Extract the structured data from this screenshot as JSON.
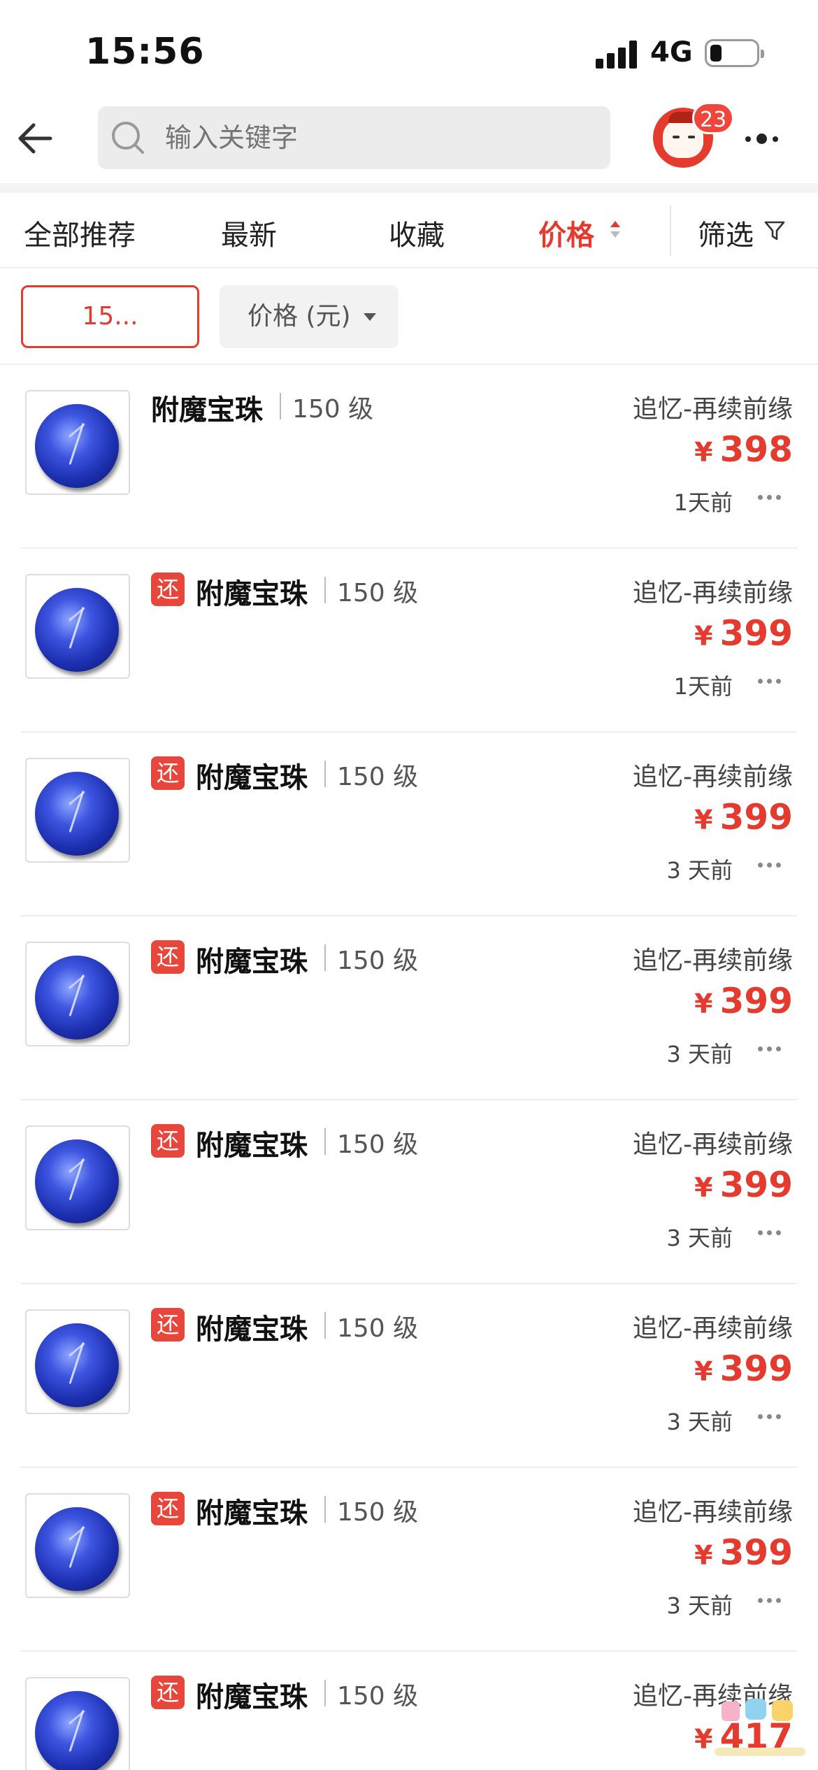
{
  "status_bar": {
    "time": "15:56",
    "network": "4G"
  },
  "header": {
    "search_placeholder": "输入关键字",
    "notification_count": "23"
  },
  "sort_tabs": [
    {
      "label": "全部推荐",
      "active": false
    },
    {
      "label": "最新",
      "active": false
    },
    {
      "label": "收藏",
      "active": false
    },
    {
      "label": "价格",
      "active": true
    },
    {
      "label": "筛选",
      "active": false
    }
  ],
  "filters": {
    "price_value": "15...",
    "price_unit": "价格 (元)"
  },
  "items": [
    {
      "tag": "",
      "name": "附魔宝珠",
      "level": "150 级",
      "server": "追忆-再续前缘",
      "currency": "¥",
      "price": "398",
      "time": "1天前"
    },
    {
      "tag": "还",
      "name": "附魔宝珠",
      "level": "150 级",
      "server": "追忆-再续前缘",
      "currency": "¥",
      "price": "399",
      "time": "1天前"
    },
    {
      "tag": "还",
      "name": "附魔宝珠",
      "level": "150 级",
      "server": "追忆-再续前缘",
      "currency": "¥",
      "price": "399",
      "time": "3 天前"
    },
    {
      "tag": "还",
      "name": "附魔宝珠",
      "level": "150 级",
      "server": "追忆-再续前缘",
      "currency": "¥",
      "price": "399",
      "time": "3 天前"
    },
    {
      "tag": "还",
      "name": "附魔宝珠",
      "level": "150 级",
      "server": "追忆-再续前缘",
      "currency": "¥",
      "price": "399",
      "time": "3 天前"
    },
    {
      "tag": "还",
      "name": "附魔宝珠",
      "level": "150 级",
      "server": "追忆-再续前缘",
      "currency": "¥",
      "price": "399",
      "time": "3 天前"
    },
    {
      "tag": "还",
      "name": "附魔宝珠",
      "level": "150 级",
      "server": "追忆-再续前缘",
      "currency": "¥",
      "price": "399",
      "time": "3 天前"
    },
    {
      "tag": "还",
      "name": "附魔宝珠",
      "level": "150 级",
      "server": "追忆-再续前缘",
      "currency": "¥",
      "price": "417",
      "time": ""
    }
  ],
  "colors": {
    "accent": "#e53b2f",
    "tag_bg": "#e8463b",
    "search_bg": "#ececec"
  },
  "icons": {
    "back": "arrow-left-icon",
    "search": "search-icon",
    "more": "more-dots-icon",
    "sort": "sort-arrows-icon",
    "filter": "funnel-icon"
  }
}
